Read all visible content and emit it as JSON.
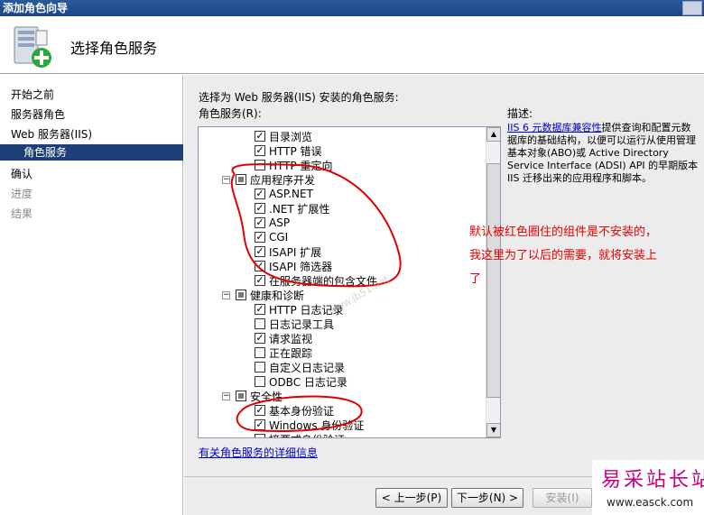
{
  "window": {
    "title": "添加角色向导"
  },
  "header": {
    "title": "选择角色服务"
  },
  "nav": {
    "items": [
      {
        "label": "开始之前",
        "state": "normal"
      },
      {
        "label": "服务器角色",
        "state": "normal"
      },
      {
        "label": "Web 服务器(IIS)",
        "state": "normal"
      },
      {
        "label": "角色服务",
        "state": "active"
      },
      {
        "label": "确认",
        "state": "normal"
      },
      {
        "label": "进度",
        "state": "disabled"
      },
      {
        "label": "结果",
        "state": "disabled"
      }
    ]
  },
  "main": {
    "intro": "选择为 Web 服务器(IIS) 安装的角色服务:",
    "column_label": "角色服务(R):",
    "tree": [
      {
        "label": "目录浏览",
        "checked": true
      },
      {
        "label": "HTTP 错误",
        "checked": true
      },
      {
        "label": "HTTP 重定向",
        "checked": false
      },
      {
        "label": "应用程序开发",
        "checked": "partial",
        "group": true
      },
      {
        "label": "ASP.NET",
        "checked": true
      },
      {
        "label": ".NET 扩展性",
        "checked": true
      },
      {
        "label": "ASP",
        "checked": true
      },
      {
        "label": "CGI",
        "checked": true
      },
      {
        "label": "ISAPI 扩展",
        "checked": true
      },
      {
        "label": "ISAPI 筛选器",
        "checked": true
      },
      {
        "label": "在服务器端的包含文件",
        "checked": true
      },
      {
        "label": "健康和诊断",
        "checked": "partial",
        "group": true
      },
      {
        "label": "HTTP 日志记录",
        "checked": true
      },
      {
        "label": "日志记录工具",
        "checked": false
      },
      {
        "label": "请求监视",
        "checked": true
      },
      {
        "label": "正在跟踪",
        "checked": false
      },
      {
        "label": "自定义日志记录",
        "checked": false
      },
      {
        "label": "ODBC 日志记录",
        "checked": false
      },
      {
        "label": "安全性",
        "checked": "partial",
        "group": true
      },
      {
        "label": "基本身份验证",
        "checked": true
      },
      {
        "label": "Windows 身份验证",
        "checked": true
      },
      {
        "label": "摘要式身份验证",
        "checked": false
      }
    ],
    "description_label": "描述:",
    "description_link": "IIS 6 元数据库兼容性",
    "description_text": "提供查询和配置元数据库的基础结构，以便可以运行从使用管理基本对象(ABO)或 Active Directory Service Interface (ADSI) API 的早期版本 IIS 迁移出来的应用程序和脚本。",
    "annotation": "默认被红色圈住的组件是不安装的，我这里为了以后的需要，就将安装上了",
    "more_info_link": "有关角色服务的详细信息",
    "inline_watermark": "www.jb51.net"
  },
  "buttons": {
    "back": "< 上一步(P)",
    "next": "下一步(N) >",
    "install": "安装(I)"
  },
  "watermark": {
    "title": "易采站长站",
    "url": "www.easck.com"
  },
  "colors": {
    "annotation": "#e60000",
    "nav_active": "#1c3f78",
    "watermark": "#c7007d"
  }
}
